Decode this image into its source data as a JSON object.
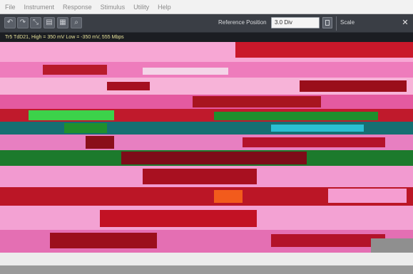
{
  "menu": [
    "File",
    "Instrument",
    "Response",
    "Stimulus",
    "Utility",
    "Help"
  ],
  "toolbar": {
    "buttons": [
      {
        "name": "undo-button",
        "icon": "undo-icon",
        "glyph": "↶"
      },
      {
        "name": "redo-button",
        "icon": "redo-icon",
        "glyph": "↷"
      },
      {
        "name": "autoscale-button",
        "icon": "autoscale-icon",
        "glyph": "⤡"
      },
      {
        "name": "save-button",
        "icon": "save-icon",
        "glyph": "▤"
      },
      {
        "name": "print-button",
        "icon": "print-icon",
        "glyph": "▦"
      },
      {
        "name": "zoom-button",
        "icon": "zoom-icon",
        "glyph": "⌕"
      }
    ],
    "reference_position_label": "Reference Position",
    "reference_position_value": "3.0 Div",
    "scale_label": "Scale"
  },
  "readout": "Tr5 TdD21, High = 350 mV Low = -350 mV, 555 Mbps",
  "colors": {
    "menubar": "#f2f2f2",
    "toolbar": "#3a3e45",
    "trace_pink": "#f48ac4",
    "trace_red": "#b01414",
    "trace_green": "#2fbf2f",
    "trace_teal": "#1e8a8a",
    "readout_text": "#e7e29a"
  }
}
